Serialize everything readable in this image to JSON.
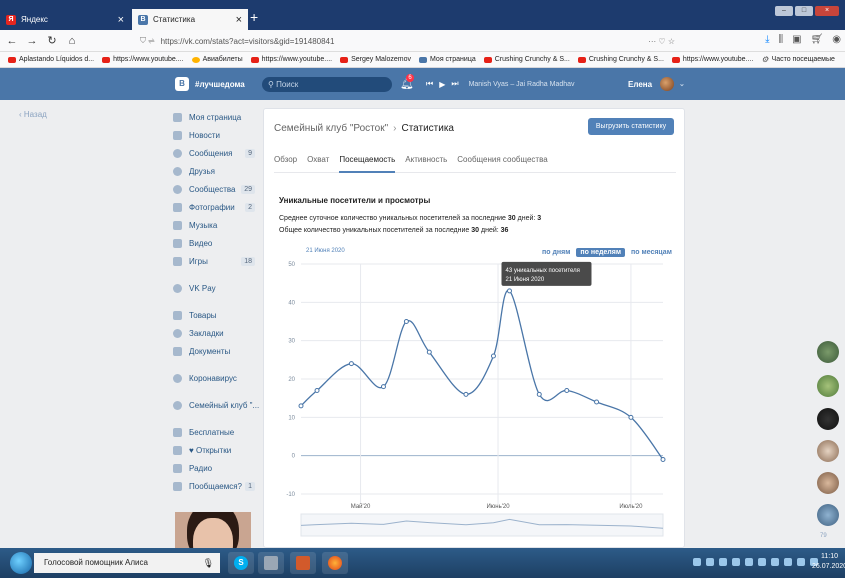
{
  "browser": {
    "tabs": [
      {
        "label": "Яндекс",
        "favicon": "Я"
      },
      {
        "label": "Статистика",
        "favicon": "vk"
      }
    ],
    "new_tab": "+",
    "url": "https://vk.com/stats?act=visitors&gid=191480841",
    "url_menu": "··· ♡ ☆",
    "bookmarks": [
      "Aplastando Líquidos d...",
      "https://www.youtube....",
      "Авиабилеты",
      "https://www.youtube....",
      "Sergey Malozemov",
      "Моя страница",
      "Crushing Crunchy & S...",
      "Crushing Crunchy & S...",
      "https://www.youtube....",
      "Часто посещаемые"
    ]
  },
  "vk_header": {
    "group": "#лучшедома",
    "search_placeholder": "Поиск",
    "notif_count": "6",
    "track": "Manish Vyas – Jai Radha Madhav",
    "user": "Елена"
  },
  "back": "Назад",
  "menu": [
    {
      "label": "Моя страница",
      "count": ""
    },
    {
      "label": "Новости",
      "count": ""
    },
    {
      "label": "Сообщения",
      "count": "9"
    },
    {
      "label": "Друзья",
      "count": ""
    },
    {
      "label": "Сообщества",
      "count": "29"
    },
    {
      "label": "Фотографии",
      "count": "2"
    },
    {
      "label": "Музыка",
      "count": ""
    },
    {
      "label": "Видео",
      "count": ""
    },
    {
      "label": "Игры",
      "count": "18"
    }
  ],
  "menu2": [
    {
      "label": "VK Pay"
    }
  ],
  "menu3": [
    {
      "label": "Товары"
    },
    {
      "label": "Закладки"
    },
    {
      "label": "Документы"
    }
  ],
  "menu4": [
    {
      "label": "Коронавирус"
    }
  ],
  "menu5": [
    {
      "label": "Семейный клуб \"..."
    }
  ],
  "menu6": [
    {
      "label": "Бесплатные",
      "count": ""
    },
    {
      "label": "♥ Открытки",
      "count": ""
    },
    {
      "label": "Радио",
      "count": ""
    },
    {
      "label": "Пообщаемся?",
      "count": "1"
    }
  ],
  "panel": {
    "crumb": "Семейный клуб \"Росток\"",
    "sep": "›",
    "title": "Статистика",
    "export": "Выгрузить статистику",
    "tabs": [
      "Обзор",
      "Охват",
      "Посещаемость",
      "Активность",
      "Сообщения сообщества"
    ],
    "active_tab": 2,
    "section": "Уникальные посетители и просмотры",
    "stat1_prefix": "Среднее суточное количество уникальных посетителей за последние ",
    "stat1_days": "30",
    "stat1_mid": " дней: ",
    "stat1_value": "3",
    "stat2_prefix": "Общее количество уникальных посетителей за последние ",
    "stat2_days": "30",
    "stat2_mid": " дней: ",
    "stat2_value": "36",
    "date_range": "21 Июня 2020",
    "modes": [
      "по дням",
      "по неделям",
      "по месяцам"
    ],
    "active_mode": 1
  },
  "chart_data": {
    "type": "line",
    "series": [
      {
        "points": [
          [
            0,
            13
          ],
          [
            0.35,
            17
          ],
          [
            1.1,
            24
          ],
          [
            1.8,
            18
          ],
          [
            2.3,
            35
          ],
          [
            2.8,
            27
          ],
          [
            3.6,
            16
          ],
          [
            4.2,
            26
          ],
          [
            4.55,
            43
          ],
          [
            5.2,
            16
          ],
          [
            5.8,
            17
          ],
          [
            6.45,
            14
          ],
          [
            7.2,
            10
          ],
          [
            7.9,
            -1
          ]
        ]
      }
    ],
    "y_ticks": [
      50,
      40,
      30,
      20,
      10,
      0,
      -10
    ],
    "ylim": [
      -10,
      50
    ],
    "x_labels": [
      {
        "label": "Май'20",
        "x": 1.3
      },
      {
        "label": "Июнь'20",
        "x": 4.3
      },
      {
        "label": "Июль'20",
        "x": 7.2
      }
    ],
    "xlim": [
      0,
      7.9
    ],
    "grid": true,
    "tooltip": {
      "x": 4.55,
      "y": 43,
      "line1": "43 уникальных посетителя",
      "line2": "21 Июня 2020"
    },
    "color": "#4a76a8"
  },
  "right_sidebar": {
    "count": "79"
  },
  "taskbar": {
    "assistant": "Голосовой помощник Алиса",
    "time": "11:10",
    "date": "26.07.2020"
  }
}
